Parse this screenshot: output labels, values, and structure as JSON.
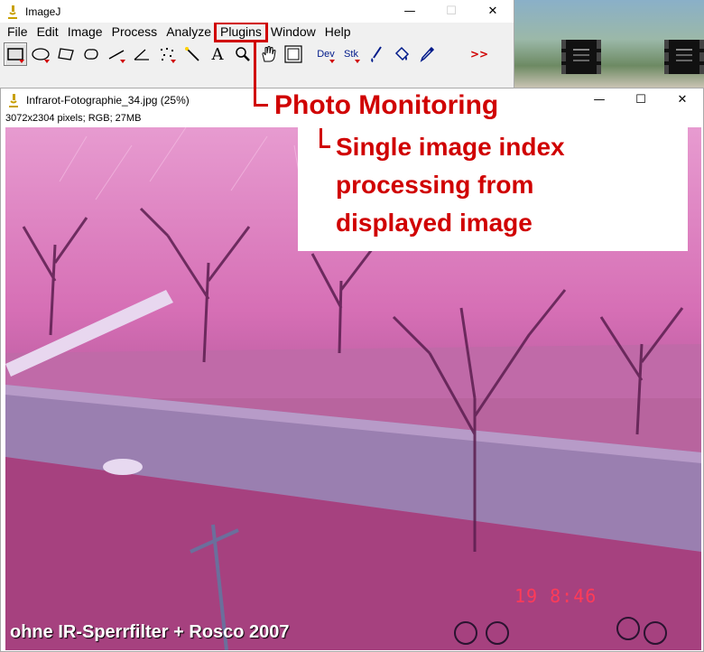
{
  "desktop": {
    "thumbnails": 2
  },
  "main_window": {
    "title": "ImageJ",
    "controls": {
      "minimize": "—",
      "maximize": "☐",
      "close": "✕"
    }
  },
  "menubar": {
    "items": [
      "File",
      "Edit",
      "Image",
      "Process",
      "Analyze",
      "Plugins",
      "Window",
      "Help"
    ],
    "highlighted": "Plugins"
  },
  "toolbar": {
    "tools": [
      {
        "name": "rectangle-tool-icon"
      },
      {
        "name": "oval-tool-icon"
      },
      {
        "name": "polygon-tool-icon"
      },
      {
        "name": "freehand-tool-icon"
      },
      {
        "name": "line-tool-icon"
      },
      {
        "name": "angle-tool-icon"
      },
      {
        "name": "multipoint-tool-icon"
      },
      {
        "name": "wand-tool-icon"
      },
      {
        "name": "text-tool-icon"
      },
      {
        "name": "magnifier-tool-icon"
      },
      {
        "name": "hand-tool-icon"
      },
      {
        "name": "color-picker-icon"
      }
    ],
    "dev_label": "Dev",
    "stk_label": "Stk",
    "more_label": ">>"
  },
  "image_window": {
    "title": "Infrarot-Fotographie_34.jpg (25%)",
    "info": "3072x2304 pixels; RGB; 27MB",
    "controls": {
      "minimize": "—",
      "maximize": "☐",
      "close": "✕"
    },
    "caption": "ohne IR-Sperrfilter + Rosco 2007",
    "timestamp": "19  8:46"
  },
  "annotation": {
    "title": "Photo Monitoring",
    "subtitle_lines": [
      "Single image index",
      "processing from",
      "displayed image"
    ],
    "color": "#d00000"
  }
}
